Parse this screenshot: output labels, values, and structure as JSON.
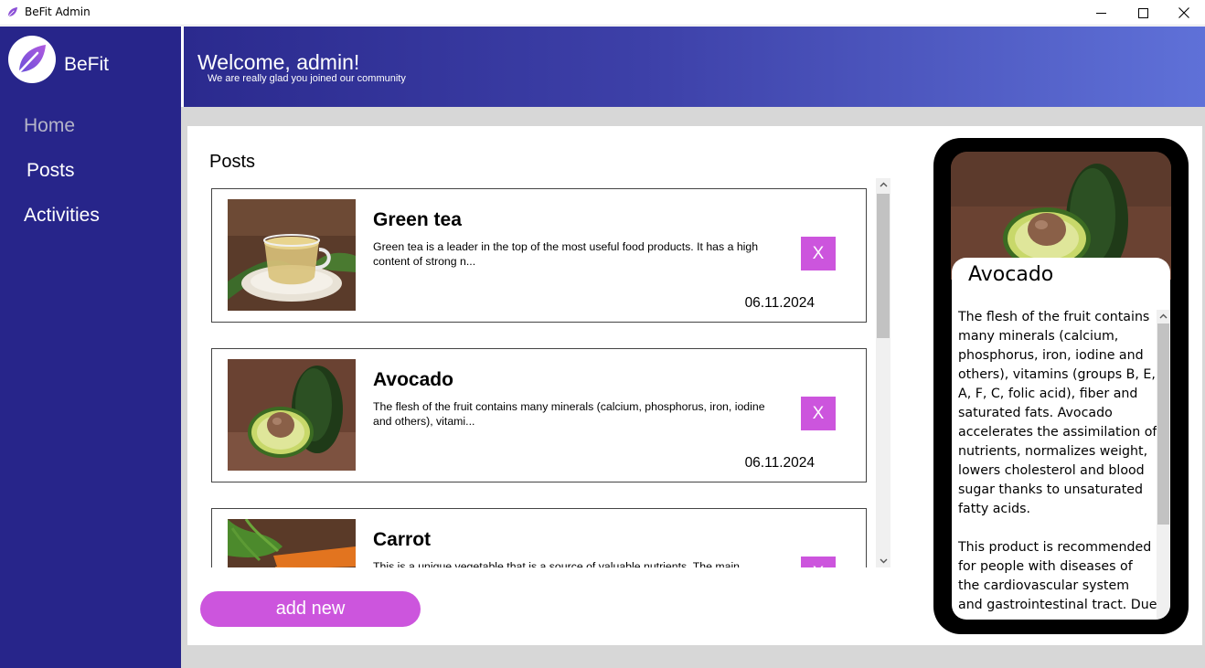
{
  "window": {
    "title": "BeFit Admin",
    "icon": "leaf-icon",
    "controls": [
      "minimize-icon",
      "maximize-icon",
      "close-icon"
    ]
  },
  "sidebar": {
    "brand": "BeFit",
    "logo_icon": "leaf-icon",
    "items": [
      {
        "label": "Home"
      },
      {
        "label": "Posts"
      },
      {
        "label": "Activities"
      }
    ]
  },
  "header": {
    "welcome": "Welcome, admin!",
    "subtitle": "We are really glad you joined our community"
  },
  "posts": {
    "title": "Posts",
    "delete_label": "X",
    "add_new_label": "add new",
    "items": [
      {
        "title": "Green tea",
        "description": "Green tea is a leader in the top of the most useful food products. It has a high content of strong n...",
        "date": "06.11.2024",
        "image": "green-tea-cup"
      },
      {
        "title": "Avocado",
        "description": "The flesh of the fruit contains many minerals (calcium, phosphorus, iron, iodine and others), vitami...",
        "date": "06.11.2024",
        "image": "avocado-halves"
      },
      {
        "title": "Carrot",
        "description": "This is a unique vegetable that is a source of valuable nutrients. The main",
        "date": "",
        "image": "carrot-bunch"
      }
    ]
  },
  "detail": {
    "title": "Avocado",
    "text": "The flesh of the fruit contains many minerals (calcium, phosphorus, iron, iodine and others), vitamins (groups B, E, A, F, C, folic acid), fiber and saturated fats. Avocado accelerates the assimilation of nutrients, normalizes weight, lowers cholesterol and blood sugar thanks to unsaturated fatty acids.\n\nThis product is recommended for people with diseases of the cardiovascular system and gastrointestinal tract. Due to"
  },
  "colors": {
    "sidebar": "#27258a",
    "accent": "#cc55dd",
    "header_start": "#2b2a8e",
    "header_end": "#5f71d8",
    "frame": "#d7d7d7"
  }
}
